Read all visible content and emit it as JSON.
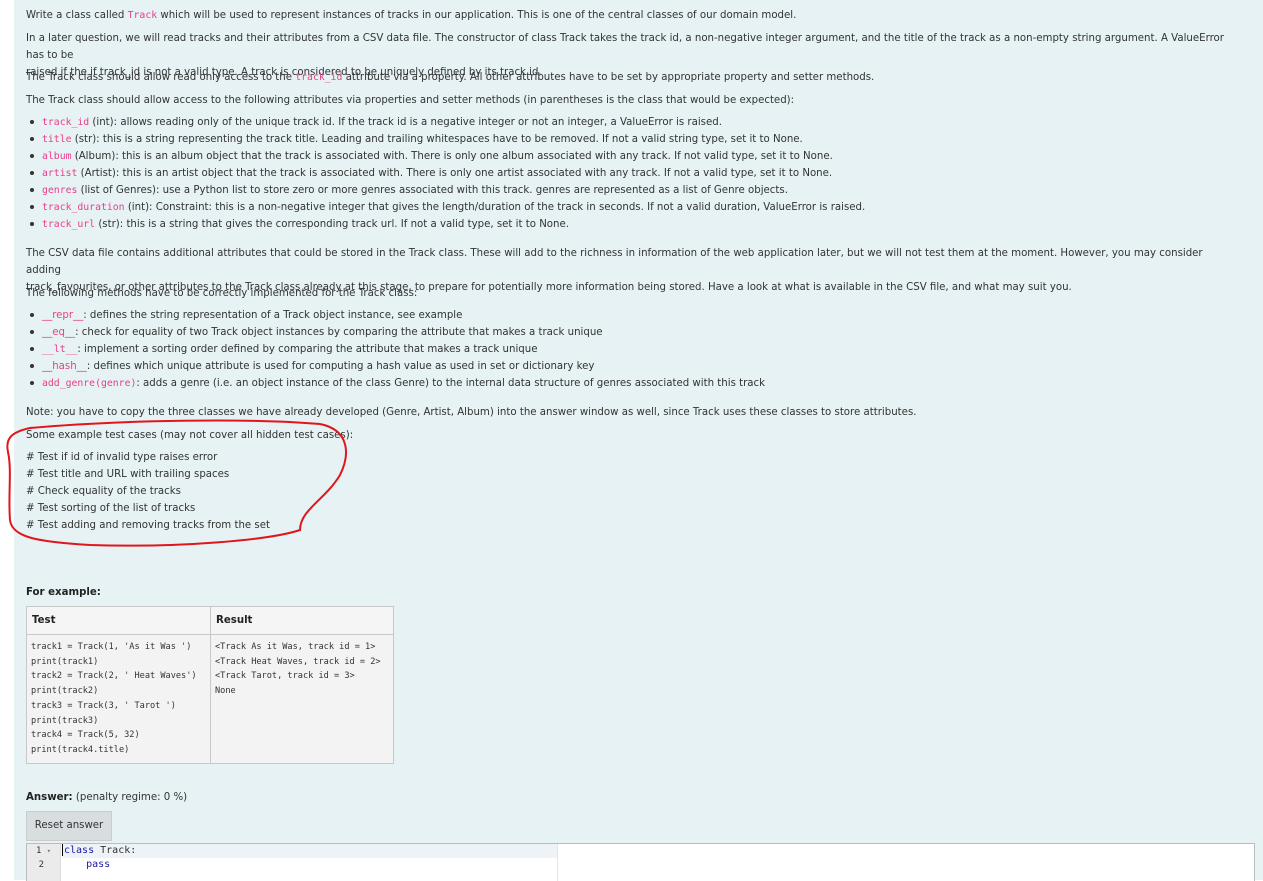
{
  "intro": {
    "p1_a": "Write a class called ",
    "p1_code": "Track",
    "p1_b": " which will be used to represent instances of tracks in our application. This is one of the central classes of our domain model.",
    "p2_line1": "In a later question, we will read tracks and their attributes from a CSV data file. The constructor of class Track takes the track id, a non-negative integer argument, and the title of the track as a non-empty string argument. A ValueError has to be",
    "p2_line2": "raised if the if track_id is not a valid type. A track is considered to be uniquely defined by its track id.",
    "p3_a": "The Track class should allow read only access to the ",
    "p3_code": "track_id",
    "p3_b": " attribute via a property. All other attributes have to be set by appropriate property and setter methods.",
    "p4": "The Track class should allow access to the following attributes via properties and setter methods (in parentheses is the class that would be expected):"
  },
  "attributes": [
    {
      "code": "track_id",
      "text": " (int): allows reading only of the unique track id. If the track id is a negative integer or not an integer, a ValueError is raised."
    },
    {
      "code": "title",
      "text": " (str): this is a string representing the track title. Leading and trailing whitespaces have to be removed. If not a valid string type, set it to None."
    },
    {
      "code": "album",
      "text": " (Album): this is an album object that the track is associated with. There is only one album associated with any track. If not valid type, set it to None."
    },
    {
      "code": "artist",
      "text": " (Artist): this is an artist object that the track is associated with. There is only one artist associated with any track. If not a valid type, set it to None."
    },
    {
      "code": "genres",
      "text": " (list of Genres): use a Python list to store zero or more genres associated with this track. genres are represented as a list of Genre objects."
    },
    {
      "code": "track_duration",
      "text": " (int): Constraint: this is a non-negative integer that gives the length/duration of the track in seconds. If not a valid duration, ValueError is raised."
    },
    {
      "code": "track_url",
      "text": "  (str): this is a string that gives the corresponding track url. If not a valid type, set it to None."
    }
  ],
  "csv": {
    "line1": "The CSV data file contains additional attributes that could be stored in the Track class. These will add to the richness in information of the web application later, but we will not test them at the moment. However, you may consider adding",
    "line2": "track_favourites, or other attributes to the Track class already at this stage, to prepare for potentially more information being stored. Have a look at what is available in the CSV file, and what may suit you."
  },
  "methods_intro": "The following methods have to be correctly implemented for the Track class:",
  "methods": [
    {
      "prefix": "__repr__",
      "text": ": defines the string representation of a Track object instance, see example"
    },
    {
      "prefix": "__eq__",
      "text": ": check for equality of two Track object instances by comparing the attribute that makes a track unique"
    },
    {
      "prefix": "__lt__",
      "text": ": implement a sorting order defined by comparing the attribute that makes a track unique"
    },
    {
      "prefix": "__hash__",
      "text": ": defines which unique attribute is used for computing a hash value as used in set or dictionary key"
    },
    {
      "prefix": "add_genre(genre)",
      "text": ": adds a genre (i.e. an object instance of the class Genre) to the internal data structure of genres associated with this track"
    }
  ],
  "note": "Note: you have to copy the three classes we have already developed (Genre, Artist, Album) into the answer window as well, since Track uses these classes to store attributes.",
  "test_cases_intro": "Some example test cases (may not cover all hidden test cases):",
  "test_cases": [
    "# Test if id of invalid type raises error",
    "# Test title and URL with trailing spaces",
    "# Check equality of the tracks",
    "# Test sorting of the list of tracks",
    "# Test adding and removing tracks from the set"
  ],
  "example_heading": "For example:",
  "example_table": {
    "headers": [
      "Test",
      "Result"
    ],
    "test": "track1 = Track(1, 'As it Was ')\nprint(track1)\ntrack2 = Track(2, ' Heat Waves')\nprint(track2)\ntrack3 = Track(3, ' Tarot ')\nprint(track3)\ntrack4 = Track(5, 32)\nprint(track4.title)",
    "result": "<Track As it Was, track id = 1>\n<Track Heat Waves, track id = 2>\n<Track Tarot, track id = 3>\nNone"
  },
  "answer": {
    "label": "Answer:",
    "penalty": "(penalty regime: 0 %)",
    "reset_label": "Reset answer"
  },
  "editor": {
    "lines": [
      {
        "num": "1",
        "fold": "▾",
        "kw": "class",
        "rest": " Track:"
      },
      {
        "num": "2",
        "fold": "",
        "kw": "    pass",
        "rest": ""
      }
    ]
  },
  "colors": {
    "panel_bg": "#e6f2f4",
    "code_accent": "#e83e8c",
    "annotation": "#e0161c"
  }
}
